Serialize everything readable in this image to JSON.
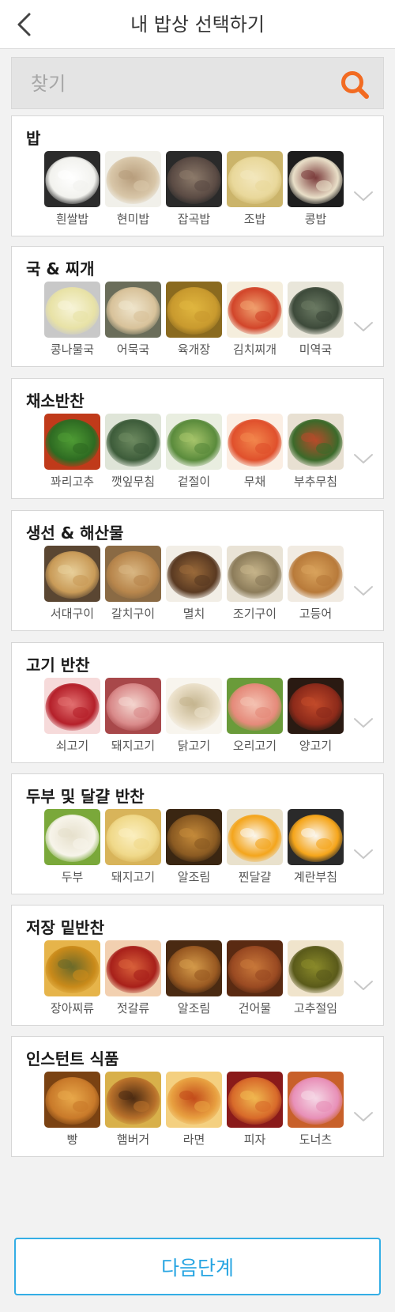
{
  "header": {
    "title": "내 밥상 선택하기",
    "back_icon": "chevron-left-icon"
  },
  "search": {
    "placeholder": "찾기",
    "value": "",
    "icon": "search-icon",
    "icon_color": "#f26b22"
  },
  "sections": [
    {
      "title": "밥",
      "items": [
        {
          "label": "흰쌀밥",
          "colors": [
            "#f2f2ee",
            "#ffffff",
            "#2b2b2b"
          ]
        },
        {
          "label": "현미밥",
          "colors": [
            "#d8c6a8",
            "#b79d7c",
            "#f1f0ea"
          ]
        },
        {
          "label": "잡곡밥",
          "colors": [
            "#5b4b44",
            "#8c7a6a",
            "#2a2a2a"
          ]
        },
        {
          "label": "조밥",
          "colors": [
            "#e9d89b",
            "#f3e7bd",
            "#cbb46a"
          ]
        },
        {
          "label": "콩밥",
          "colors": [
            "#e9dfc8",
            "#7a3b3b",
            "#1e1e1e"
          ]
        }
      ]
    },
    {
      "title": "국 & 찌개",
      "items": [
        {
          "label": "콩나물국",
          "colors": [
            "#e8e2a6",
            "#f7f4d8",
            "#c8c8c8"
          ]
        },
        {
          "label": "어묵국",
          "colors": [
            "#d8c29a",
            "#efe5cc",
            "#6a6d5a"
          ]
        },
        {
          "label": "육개장",
          "colors": [
            "#c99a2e",
            "#e0b63f",
            "#8a6a1f"
          ]
        },
        {
          "label": "김치찌개",
          "colors": [
            "#d2452a",
            "#f0a06e",
            "#f5eedd"
          ]
        },
        {
          "label": "미역국",
          "colors": [
            "#3d4a3a",
            "#6b7a63",
            "#e9e6da"
          ]
        }
      ]
    },
    {
      "title": "채소반찬",
      "items": [
        {
          "label": "꽈리고추",
          "colors": [
            "#2e6b22",
            "#4e9b34",
            "#c03a1a"
          ]
        },
        {
          "label": "깻잎무침",
          "colors": [
            "#3d5c3a",
            "#6d8a60",
            "#dfe5d8"
          ]
        },
        {
          "label": "겉절이",
          "colors": [
            "#5a8b3c",
            "#a6c46a",
            "#e9eee0"
          ]
        },
        {
          "label": "무채",
          "colors": [
            "#e0502c",
            "#f2864c",
            "#fbeee3"
          ]
        },
        {
          "label": "부추무침",
          "colors": [
            "#3b6a2a",
            "#b84a2a",
            "#e8e0d2"
          ]
        }
      ]
    },
    {
      "title": "생선 & 해산물",
      "items": [
        {
          "label": "서대구이",
          "colors": [
            "#c99b58",
            "#e8cf9a",
            "#5a4632"
          ]
        },
        {
          "label": "갈치구이",
          "colors": [
            "#b8864c",
            "#d9b783",
            "#8a6a44"
          ]
        },
        {
          "label": "멸치",
          "colors": [
            "#5a3a22",
            "#9a6a3a",
            "#f2eee6"
          ]
        },
        {
          "label": "조기구이",
          "colors": [
            "#8c7c5a",
            "#c6b48a",
            "#e9e3d6"
          ]
        },
        {
          "label": "고등어",
          "colors": [
            "#b87a3a",
            "#d9a35c",
            "#f1ebe2"
          ]
        }
      ]
    },
    {
      "title": "고기 반찬",
      "items": [
        {
          "label": "쇠고기",
          "colors": [
            "#b5202a",
            "#e27070",
            "#f6dada"
          ]
        },
        {
          "label": "돼지고기",
          "colors": [
            "#d98a8a",
            "#f4d6cf",
            "#a8484a"
          ]
        },
        {
          "label": "닭고기",
          "colors": [
            "#eadfc8",
            "#c4b48e",
            "#f8f5ee"
          ]
        },
        {
          "label": "오리고기",
          "colors": [
            "#e58a7a",
            "#f4c2b2",
            "#6a9b3a"
          ]
        },
        {
          "label": "양고기",
          "colors": [
            "#8c2a1a",
            "#c24a2a",
            "#2a1a12"
          ]
        }
      ]
    },
    {
      "title": "두부 및 달걀 반찬",
      "items": [
        {
          "label": "두부",
          "colors": [
            "#f7f4ea",
            "#e6e0cc",
            "#7aa83a"
          ]
        },
        {
          "label": "돼지고기",
          "colors": [
            "#f0d98a",
            "#fbefc0",
            "#d8b45a"
          ]
        },
        {
          "label": "알조림",
          "colors": [
            "#8a5a22",
            "#c48a3a",
            "#3a2612"
          ]
        },
        {
          "label": "찐달걀",
          "colors": [
            "#f4a51c",
            "#fbf7ee",
            "#e9e1cc"
          ]
        },
        {
          "label": "계란부침",
          "colors": [
            "#f5a51a",
            "#fbf7f0",
            "#2a2a2a"
          ]
        }
      ]
    },
    {
      "title": "저장 밑반찬",
      "items": [
        {
          "label": "장아찌류",
          "colors": [
            "#c98a1a",
            "#6a6a2a",
            "#e6b44a"
          ]
        },
        {
          "label": "젓갈류",
          "colors": [
            "#a8201a",
            "#d8603a",
            "#f2d0b0"
          ]
        },
        {
          "label": "알조림",
          "colors": [
            "#9a5a22",
            "#d49a4a",
            "#4a2a12"
          ]
        },
        {
          "label": "건어물",
          "colors": [
            "#9a4a22",
            "#c8783a",
            "#5a2a12"
          ]
        },
        {
          "label": "고추절임",
          "colors": [
            "#5a5a1a",
            "#8a8a2a",
            "#f0e4cc"
          ]
        }
      ]
    },
    {
      "title": "인스턴트 식품",
      "items": [
        {
          "label": "빵",
          "colors": [
            "#c97a2a",
            "#e8a84a",
            "#7a4212"
          ]
        },
        {
          "label": "햄버거",
          "colors": [
            "#b8702a",
            "#4a2a12",
            "#d8b04a"
          ]
        },
        {
          "label": "라면",
          "colors": [
            "#e8a040",
            "#c24a1a",
            "#f4d080"
          ]
        },
        {
          "label": "피자",
          "colors": [
            "#d86a2a",
            "#f0b850",
            "#8a1a1a"
          ]
        },
        {
          "label": "도너츠",
          "colors": [
            "#e890b8",
            "#f5d8e6",
            "#c8602a"
          ]
        }
      ]
    }
  ],
  "next_button": {
    "label": "다음단계"
  },
  "colors": {
    "accent": "#27a5e2",
    "search_icon": "#f26b22"
  }
}
